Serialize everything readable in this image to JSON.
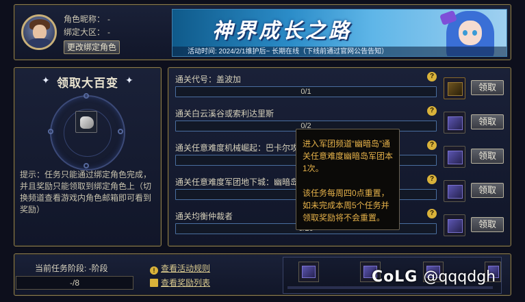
{
  "header": {
    "role_name_label": "角色昵称：",
    "role_name_value": "-",
    "region_label": "绑定大区：",
    "region_value": "-",
    "change_role_button": "更改绑定角色",
    "banner_title": "神界成长之路",
    "banner_subtitle": "活动时间: 2024/2/1维护后~ 长期在线（下线前通过官网公告告知）"
  },
  "left_panel": {
    "title": "领取大百变",
    "hint": "提示：任务只能通过绑定角色完成，并且奖励只能领取到绑定角色上（切换频道查看游戏内角色邮箱即可看到奖励）"
  },
  "tasks": [
    {
      "name": "通关代号：盖波加",
      "progress_text": "0/1",
      "progress": 0,
      "claim_label": "领取",
      "reward_icon": "gold-box-icon"
    },
    {
      "name": "通关白云溪谷或索利达里斯",
      "progress_text": "0/2",
      "progress": 0,
      "claim_label": "领取",
      "reward_icon": "purple-box-icon"
    },
    {
      "name": "通关任意难度机械崛起：巴卡尔攻坚战",
      "progress_text": "",
      "progress": 0,
      "claim_label": "领取",
      "reward_icon": "purple-box-icon"
    },
    {
      "name": "通关任意难度军团地下城：幽暗岛军团本",
      "progress_text": "",
      "progress": 0,
      "claim_label": "领取",
      "reward_icon": "purple-box-icon"
    },
    {
      "name": "通关均衡仲裁者",
      "progress_text": "0/20",
      "progress": 0,
      "claim_label": "领取",
      "reward_icon": "purple-box-icon"
    }
  ],
  "help_glyph": "?",
  "tooltip": {
    "paragraph1": "进入军团频道“幽暗岛”通关任意难度幽暗岛军团本1次。",
    "paragraph2": "该任务每周四0点重置，如未完成本周5个任务并领取奖励将不会重置。"
  },
  "bottom": {
    "stage_label": "当前任务阶段: -阶段",
    "stage_value": "-/8",
    "rules_link": "查看活动规则",
    "rewards_link": "查看奖励列表"
  },
  "watermark": {
    "brand": "CoLG",
    "handle": "@qqqdgh"
  },
  "colors": {
    "accent_gold": "#d9b23a",
    "progress_border": "#4a6fa0",
    "tooltip_text": "#e6b24a"
  }
}
